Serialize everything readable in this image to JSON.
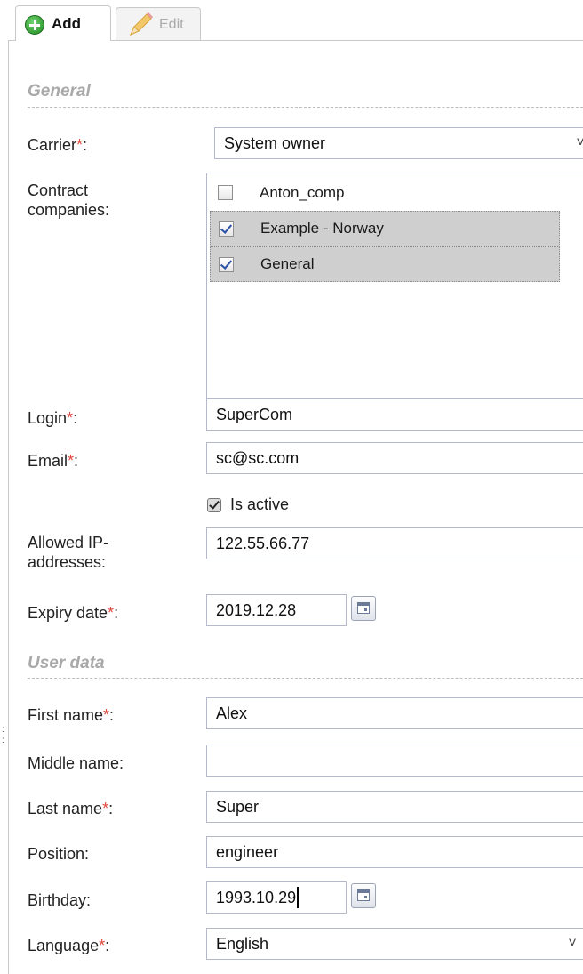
{
  "tabs": {
    "add_label": "Add",
    "edit_label": "Edit"
  },
  "sections": {
    "general": "General",
    "user_data": "User data"
  },
  "form": {
    "carrier": {
      "label": "Carrier",
      "required_mark": "*",
      "suffix": ":",
      "value": "System owner"
    },
    "contract_companies": {
      "label_line1": "Contract",
      "label_line2": "companies:",
      "items": [
        {
          "label": "Anton_comp",
          "checked": false,
          "selected": false
        },
        {
          "label": "Example - Norway",
          "checked": true,
          "selected": true
        },
        {
          "label": "General",
          "checked": true,
          "selected": true
        }
      ]
    },
    "login": {
      "label": "Login",
      "required_mark": "*",
      "suffix": ":",
      "value": "SuperCom"
    },
    "email": {
      "label": "Email",
      "required_mark": "*",
      "suffix": ":",
      "value": "sc@sc.com"
    },
    "is_active": {
      "label": "Is active",
      "checked": true
    },
    "allowed_ip": {
      "label_line1": "Allowed IP-",
      "label_line2": "addresses:",
      "value": "122.55.66.77"
    },
    "expiry_date": {
      "label": "Expiry date",
      "required_mark": "*",
      "suffix": ":",
      "value": "2019.12.28"
    },
    "first_name": {
      "label": "First name",
      "required_mark": "*",
      "suffix": ":",
      "value": "Alex"
    },
    "middle_name": {
      "label": "Middle name:",
      "value": ""
    },
    "last_name": {
      "label": "Last name",
      "required_mark": "*",
      "suffix": ":",
      "value": "Super"
    },
    "position": {
      "label": "Position:",
      "value": "engineer"
    },
    "birthday": {
      "label": "Birthday:",
      "value": "1993.10.29"
    },
    "language": {
      "label": "Language",
      "required_mark": "*",
      "suffix": ":",
      "value": "English"
    }
  },
  "colors": {
    "required": "#e0443a",
    "section_title": "#a9a9a9",
    "selected_row": "#cfcfcf",
    "field_border": "#b5b8c8"
  },
  "icons": [
    "add-circle-icon",
    "pencil-icon",
    "chevron-down-icon",
    "calendar-icon",
    "checkbox-icon"
  ]
}
